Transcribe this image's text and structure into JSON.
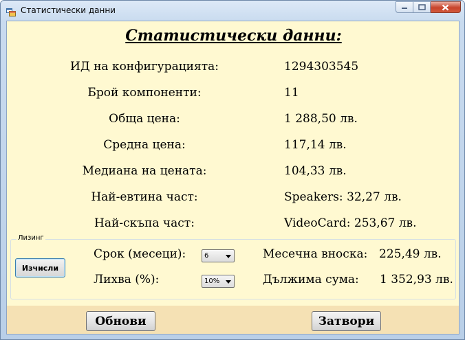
{
  "window": {
    "title": "Статистически данни",
    "icon": "form-icon"
  },
  "heading": "Статистически данни:",
  "stats": [
    {
      "label": "ИД на конфигурацията:",
      "value": "1294303545"
    },
    {
      "label": "Брой компоненти:",
      "value": "11"
    },
    {
      "label": "Обща цена:",
      "value": "1 288,50 лв."
    },
    {
      "label": "Средна цена:",
      "value": "117,14 лв."
    },
    {
      "label": "Медиана на цената:",
      "value": "104,33 лв."
    },
    {
      "label": "Най-евтина част:",
      "value": "Speakers: 32,27 лв."
    },
    {
      "label": "Най-скъпа част:",
      "value": "VideoCard: 253,67 лв."
    }
  ],
  "leasing": {
    "group_title": "Лизинг",
    "calculate_label": "Изчисли",
    "term_label": "Срок (месеци):",
    "term_value": "6",
    "interest_label": "Лихва (%):",
    "interest_value": "10%",
    "monthly_label": "Месечна вноска:",
    "monthly_value": "225,49 лв.",
    "due_label": "Дължима сума:",
    "due_value": "1 352,93 лв."
  },
  "footer": {
    "refresh_label": "Обнови",
    "close_label": "Затвори"
  }
}
